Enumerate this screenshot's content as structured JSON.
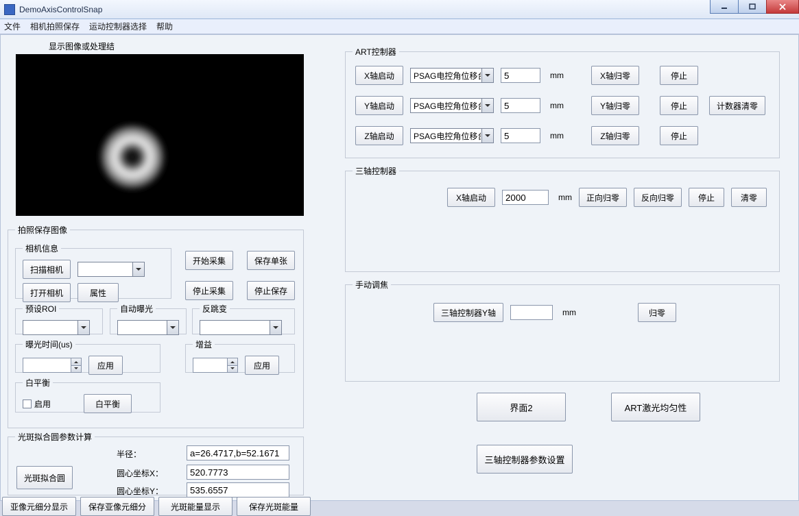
{
  "window": {
    "title": "DemoAxisControlSnap"
  },
  "menu": {
    "file": "文件",
    "camera": "相机拍照保存",
    "motion": "运动控制器选择",
    "help": "帮助"
  },
  "image_caption": "显示图像或处理结",
  "capture_group": {
    "legend": "拍照保存图像",
    "camera_info_legend": "相机信息",
    "scan_camera": "扫描相机",
    "open_camera": "打开相机",
    "props": "属性",
    "start_acq": "开始采集",
    "save_single": "保存单张",
    "stop_acq": "停止采集",
    "stop_save": "停止保存",
    "preset_roi_legend": "预设ROI",
    "auto_exposure_legend": "自动曝光",
    "antijump_legend": "反跳变",
    "exposure_legend": "曝光时间(us)",
    "gain_legend": "增益",
    "apply": "应用",
    "wb_legend": "白平衡",
    "enable": "启用",
    "wb_btn": "白平衡"
  },
  "circle_group": {
    "legend": "光斑拟合圆参数计算",
    "radius_lbl": "半径：",
    "radius_val": "a=26.4717,b=52.1671",
    "cx_lbl": "圆心坐标X：",
    "cx_val": "520.7773",
    "cy_lbl": "圆心坐标Y：",
    "cy_val": "535.6557",
    "fit_btn": "光斑拟合圆"
  },
  "bottom_buttons": {
    "subpixel_show": "亚像元细分显示",
    "subpixel_save": "保存亚像元细分",
    "energy_show": "光斑能量显示",
    "energy_save": "保存光斑能量"
  },
  "art": {
    "legend": "ART控制器",
    "x_start": "X轴启动",
    "y_start": "Y轴启动",
    "z_start": "Z轴启动",
    "option": "PSAG电控角位移台",
    "val_x": "5",
    "val_y": "5",
    "val_z": "5",
    "unit": "mm",
    "x_home": "X轴归零",
    "y_home": "Y轴归零",
    "z_home": "Z轴归零",
    "stop": "停止",
    "counter_reset": "计数器清零"
  },
  "triple": {
    "legend": "三轴控制器",
    "x_start": "X轴启动",
    "val": "2000",
    "unit": "mm",
    "fwd_home": "正向归零",
    "rev_home": "反向归零",
    "stop": "停止",
    "clear": "清零"
  },
  "focus": {
    "legend": "手动调焦",
    "label": "三轴控制器Y轴",
    "unit": "mm",
    "home": "归零"
  },
  "big_buttons": {
    "ui2": "界面2",
    "art_laser": "ART激光均匀性",
    "triple_params": "三轴控制器参数设置"
  }
}
